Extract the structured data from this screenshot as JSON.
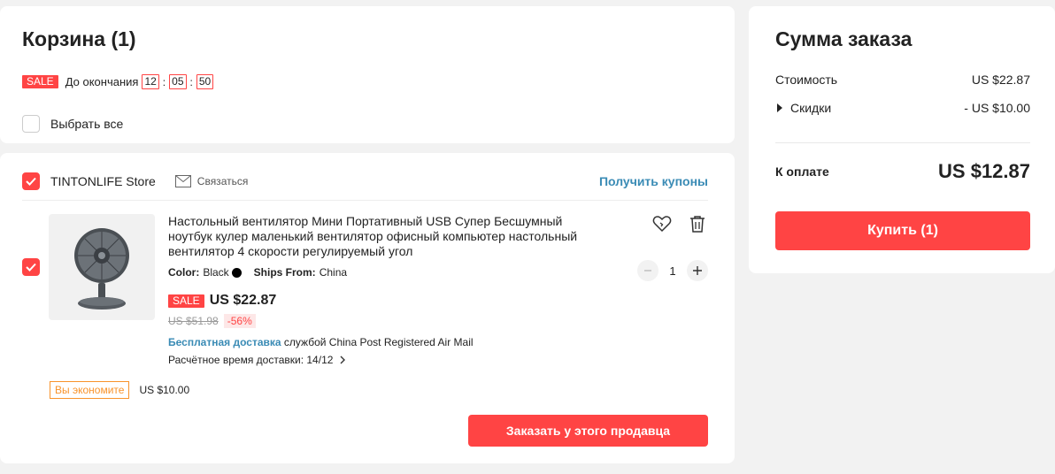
{
  "cart": {
    "title": "Корзина (1)",
    "sale_tag": "SALE",
    "countdown_label": "До окончания",
    "countdown": {
      "hours": "12",
      "minutes": "05",
      "seconds": "50"
    },
    "select_all_label": "Выбрать все"
  },
  "store": {
    "name": "TINTONLIFE Store",
    "contact_label": "Связаться",
    "coupons_label": "Получить купоны",
    "item": {
      "title": "Настольный вентилятор Мини Портативный USB Супер Бесшумный ноутбук кулер маленький вентилятор офисный компьютер настольный вентилятор 4 скорости регулируемый угол",
      "color_label": "Color:",
      "color_value": "Black",
      "ships_label": "Ships From:",
      "ships_value": "China",
      "sale_tag": "SALE",
      "price": "US $22.87",
      "old_price": "US $51.98",
      "discount": "-56%",
      "free_shipping": "Бесплатная доставка",
      "shipping_service": " службой China Post Registered Air Mail",
      "delivery_eta": "Расчётное время доставки: 14/12",
      "quantity": "1"
    },
    "savings_label": "Вы экономите",
    "savings_amount": "US $10.00",
    "order_seller_button": "Заказать у этого продавца"
  },
  "summary": {
    "title": "Сумма заказа",
    "cost_label": "Стоимость",
    "cost_value": "US $22.87",
    "discounts_label": "Скидки",
    "discounts_value": "- US $10.00",
    "total_label": "К оплате",
    "total_value": "US $12.87",
    "buy_button": "Купить (1)"
  },
  "colors": {
    "accent": "#ff4444",
    "link": "#3a8bb5",
    "savings": "#f8932b",
    "background": "#f2f2f2"
  },
  "icons": [
    "check-icon",
    "envelope-icon",
    "heart-icon",
    "trash-icon",
    "minus-icon",
    "plus-icon",
    "chevron-right-icon",
    "triangle-right-icon",
    "fan-image"
  ]
}
